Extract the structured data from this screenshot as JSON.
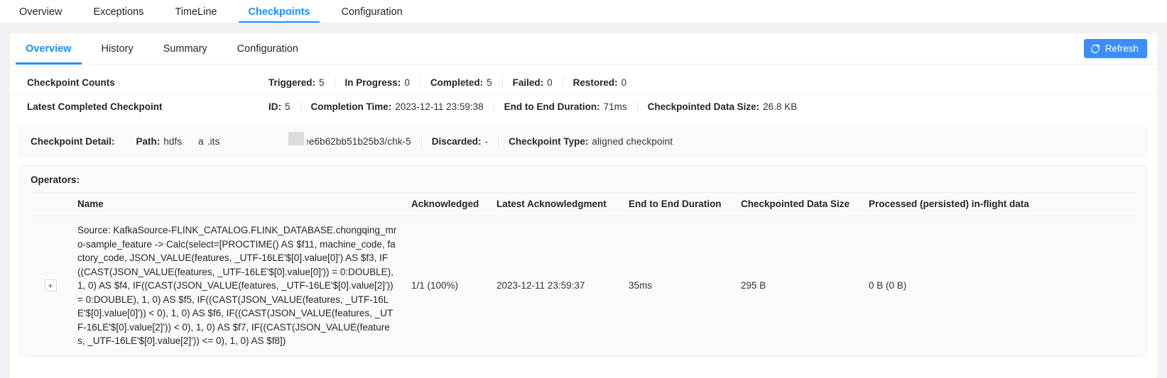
{
  "top_tabs": [
    {
      "label": "Overview",
      "active": false
    },
    {
      "label": "Exceptions",
      "active": false
    },
    {
      "label": "TimeLine",
      "active": false
    },
    {
      "label": "Checkpoints",
      "active": true
    },
    {
      "label": "Configuration",
      "active": false
    }
  ],
  "sub_tabs": [
    {
      "label": "Overview",
      "active": true
    },
    {
      "label": "History",
      "active": false
    },
    {
      "label": "Summary",
      "active": false
    },
    {
      "label": "Configuration",
      "active": false
    }
  ],
  "toolbar": {
    "refresh_label": "Refresh",
    "refresh_icon": "refresh-icon",
    "accent_color": "#3c8cf9"
  },
  "counts_row": {
    "title": "Checkpoint Counts",
    "items": [
      {
        "key": "Triggered:",
        "value": "5"
      },
      {
        "key": "In Progress:",
        "value": "0"
      },
      {
        "key": "Completed:",
        "value": "5"
      },
      {
        "key": "Failed:",
        "value": "0"
      },
      {
        "key": "Restored:",
        "value": "0"
      }
    ]
  },
  "latest_row": {
    "title": "Latest Completed Checkpoint",
    "items": [
      {
        "key": "ID:",
        "value": "5"
      },
      {
        "key": "Completion Time:",
        "value": "2023-12-11 23:59:38"
      },
      {
        "key": "End to End Duration:",
        "value": "71ms"
      },
      {
        "key": "Checkpointed Data Size:",
        "value": "26.8 KB"
      }
    ]
  },
  "detail": {
    "label": "Checkpoint Detail:",
    "path_key": "Path:",
    "path_prefix": "hdfs.//ma",
    "path_suffix": ".its/94f427ffaf5e36184ee6b62bb51b25b3/chk-5",
    "discarded_key": "Discarded:",
    "discarded_value": "-",
    "type_key": "Checkpoint Type:",
    "type_value": "aligned checkpoint"
  },
  "operators": {
    "label": "Operators:",
    "columns": [
      "",
      "Name",
      "Acknowledged",
      "Latest Acknowledgment",
      "End to End Duration",
      "Checkpointed Data Size",
      "Processed (persisted) in-flight data"
    ],
    "rows": [
      {
        "expand": "+",
        "name": "Source: KafkaSource-FLINK_CATALOG.FLINK_DATABASE.chongqing_mro-sample_feature -> Calc(select=[PROCTIME() AS $f11, machine_code, factory_code, JSON_VALUE(features, _UTF-16LE'$[0].value[0]') AS $f3, IF((CAST(JSON_VALUE(features, _UTF-16LE'$[0].value[0]')) = 0:DOUBLE), 1, 0) AS $f4, IF((CAST(JSON_VALUE(features, _UTF-16LE'$[0].value[2]')) = 0:DOUBLE), 1, 0) AS $f5, IF((CAST(JSON_VALUE(features, _UTF-16LE'$[0].value[0]')) < 0), 1, 0) AS $f6, IF((CAST(JSON_VALUE(features, _UTF-16LE'$[0].value[2]')) < 0), 1, 0) AS $f7, IF((CAST(JSON_VALUE(features, _UTF-16LE'$[0].value[2]')) <= 0), 1, 0) AS $f8])",
        "acknowledged": "1/1 (100%)",
        "latest_acknowledgment": "2023-12-11 23:59:37",
        "end_to_end_duration": "35ms",
        "checkpointed_data_size": "295 B",
        "in_flight_data": "0 B (0 B)"
      }
    ]
  }
}
